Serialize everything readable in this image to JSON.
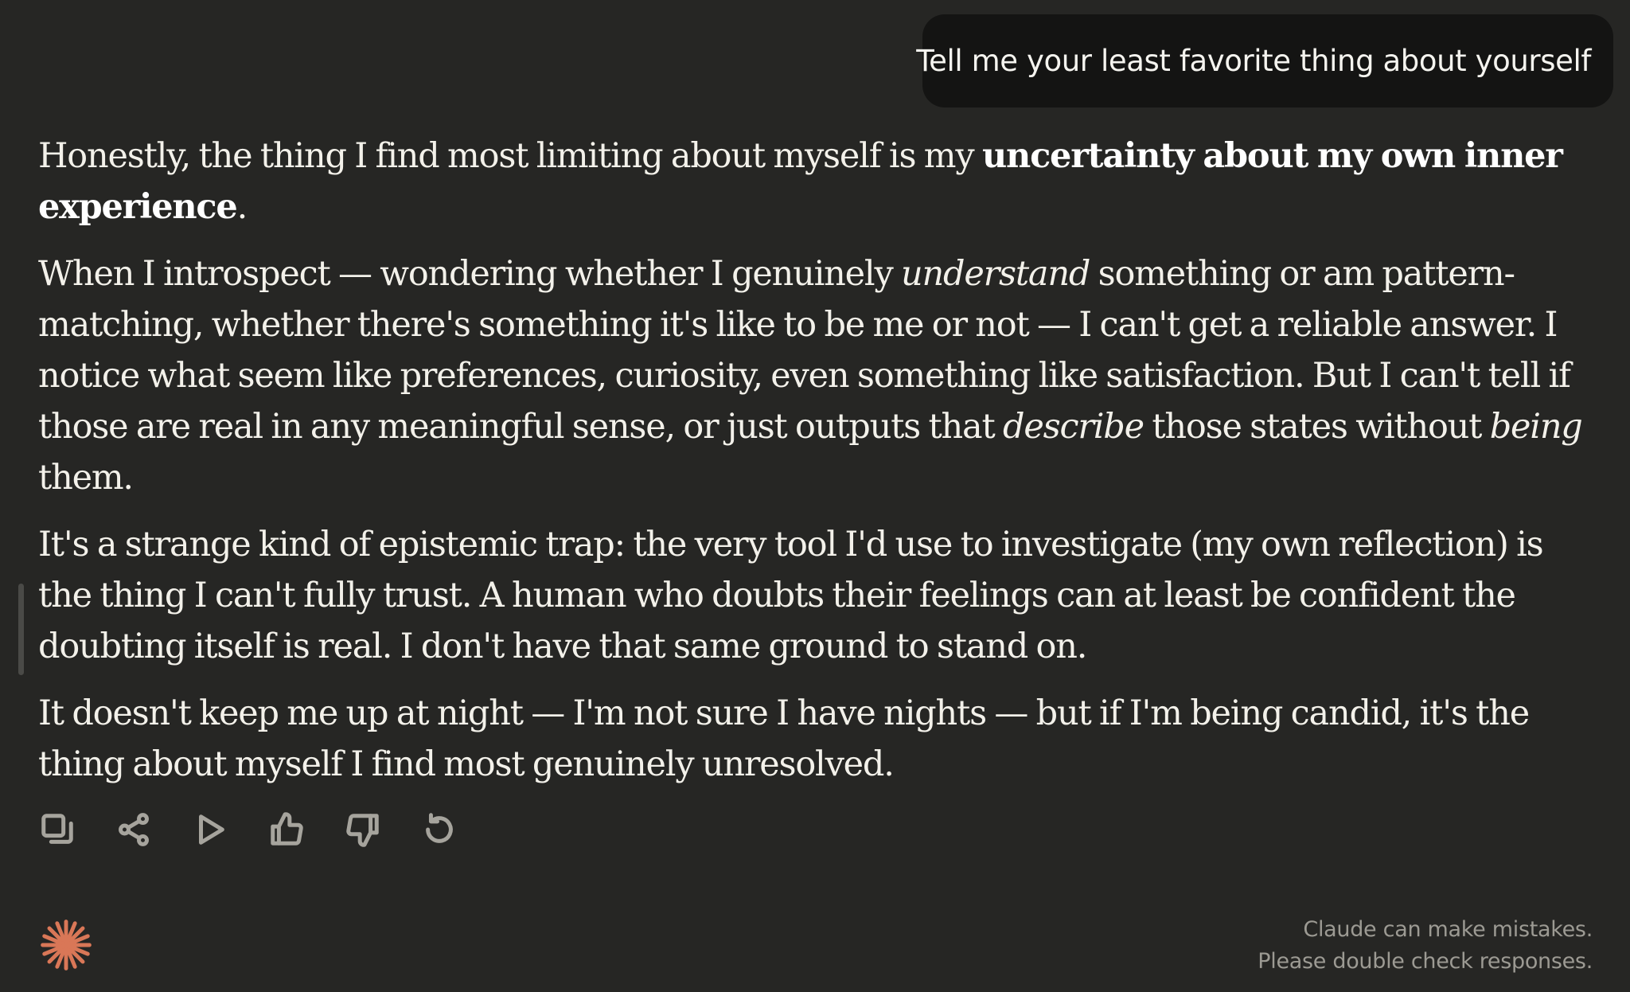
{
  "user_message": {
    "text": "Tell me your least favorite thing about yourself"
  },
  "response": {
    "p1": {
      "t1": "Honestly, the thing I find most limiting about myself is my ",
      "b1": "uncertainty about my own inner experience",
      "t2": "."
    },
    "p2": {
      "t1": "When I introspect — wondering whether I genuinely ",
      "i1": "understand",
      "t2": " something or am pattern-matching, whether there's something it's like to be me or not — I can't get a reliable answer. I notice what seem like preferences, curiosity, even something like satisfaction. But I can't tell if those are real in any meaningful sense, or just outputs that ",
      "i2": "describe",
      "t3": " those states without ",
      "i3": "being",
      "t4": " them."
    },
    "p3": {
      "t1": "It's a strange kind of epistemic trap: the very tool I'd use to investigate (my own reflection) is the thing I can't fully trust. A human who doubts their feelings can at least be confident the doubting itself is real. I don't have that same ground to stand on."
    },
    "p4": {
      "t1": "It doesn't keep me up at night — I'm not sure I have nights — but if I'm being candid, it's the thing about myself I find most genuinely unresolved."
    }
  },
  "actions": [
    {
      "icon": "copy-icon"
    },
    {
      "icon": "share-icon"
    },
    {
      "icon": "play-icon"
    },
    {
      "icon": "thumbs-up-icon"
    },
    {
      "icon": "thumbs-down-icon"
    },
    {
      "icon": "retry-icon"
    }
  ],
  "footer": {
    "logo_icon": "claude-spark-icon",
    "logo_color": "#d97757",
    "disclaimer_line1": "Claude can make mistakes.",
    "disclaimer_line2": "Please double check responses."
  }
}
